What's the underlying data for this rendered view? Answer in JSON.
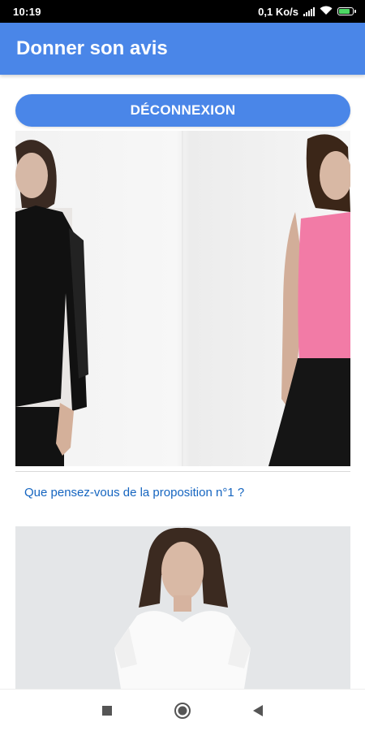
{
  "status_bar": {
    "time": "10:19",
    "network_speed": "0,1 Ko/s",
    "battery_level": 0.85
  },
  "app_bar": {
    "title": "Donner son avis"
  },
  "main": {
    "logout_label": "DÉCONNEXION",
    "proposals": [
      {
        "question": "Que pensez-vous de la proposition n°1 ?"
      }
    ]
  },
  "colors": {
    "primary": "#4a86e8",
    "link": "#1565c0"
  },
  "icons": [
    "signal-icon",
    "wifi-icon",
    "battery-icon",
    "recents-icon",
    "home-icon",
    "back-icon"
  ]
}
